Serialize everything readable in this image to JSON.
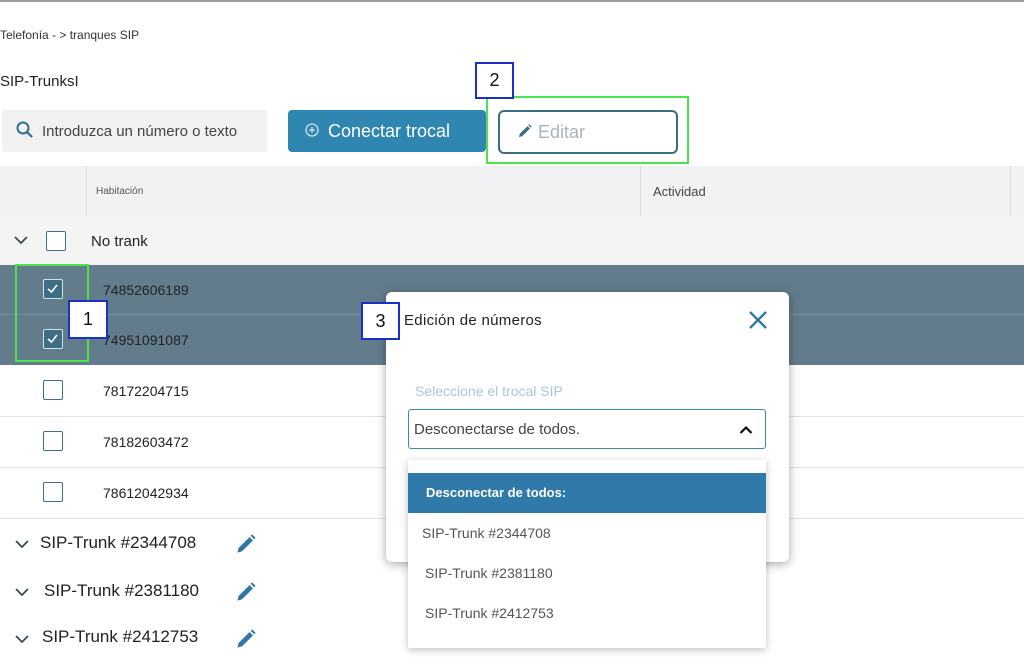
{
  "breadcrumb": "Telefonía - > tranques SIP",
  "page_title": "SIP-TrunksI",
  "search": {
    "placeholder": "Introduzca un número o texto"
  },
  "toolbar": {
    "connect_label": "Conectar trocal",
    "edit_label": "Editar"
  },
  "table": {
    "headers": [
      "Habitación",
      "Actividad"
    ],
    "group_label": "No trank",
    "rows": [
      {
        "number": "74852606189",
        "checked": true
      },
      {
        "number": "74951091087",
        "checked": true
      },
      {
        "number": "78172204715",
        "checked": false
      },
      {
        "number": "78182603472",
        "checked": false
      },
      {
        "number": "78612042934",
        "checked": false
      }
    ],
    "trunk_groups": [
      "SIP-Trunk #2344708",
      "SIP-Trunk #2381180",
      "SIP-Trunk #2412753"
    ]
  },
  "modal": {
    "title": "Edición de números",
    "select_label": "Seleccione el trocal SIP",
    "selected_value": "Desconectarse de todos.",
    "options": [
      "Desconectar de todos:",
      "SIP-Trunk #2344708",
      "SIP-Trunk #2381180",
      "SIP-Trunk #2412753"
    ]
  },
  "callouts": [
    "1",
    "2",
    "3"
  ],
  "colors": {
    "accent": "#2f86b0",
    "selected_row": "#637c8c",
    "highlight": "#4ee24e",
    "callout_border": "#1c2fc7"
  },
  "icons": [
    "search-icon",
    "add-circle-icon",
    "pencil-icon",
    "chevron-down-icon",
    "check-icon",
    "close-icon",
    "chevron-up-icon"
  ]
}
